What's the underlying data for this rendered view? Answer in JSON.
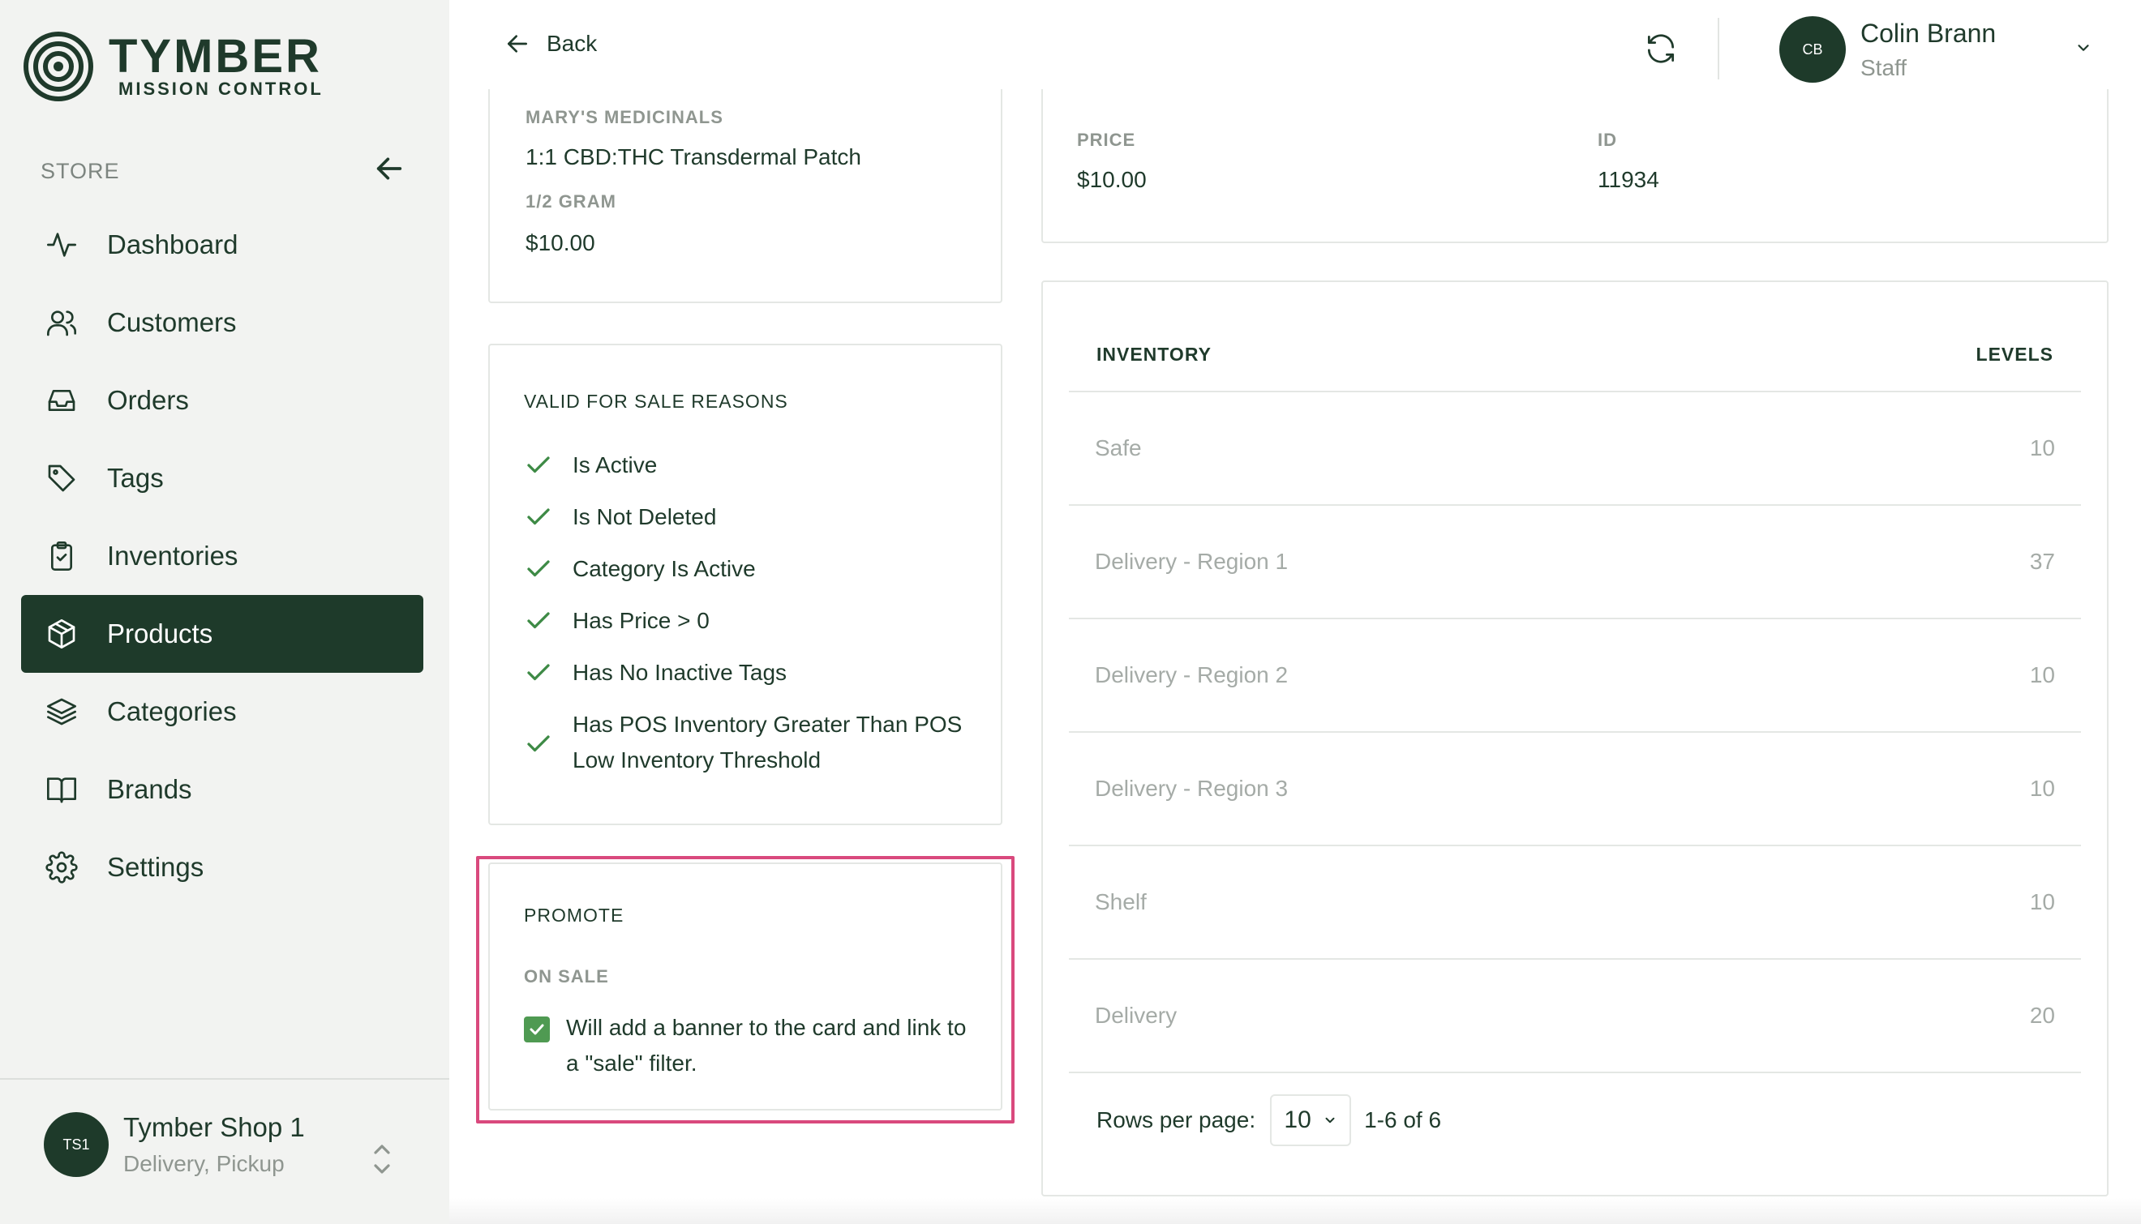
{
  "brand": {
    "title": "TYMBER",
    "subtitle": "MISSION CONTROL"
  },
  "sidebar": {
    "section_label": "STORE",
    "items": [
      {
        "label": "Dashboard",
        "icon": "activity-icon"
      },
      {
        "label": "Customers",
        "icon": "users-icon"
      },
      {
        "label": "Orders",
        "icon": "inbox-icon"
      },
      {
        "label": "Tags",
        "icon": "tag-icon"
      },
      {
        "label": "Inventories",
        "icon": "clipboard-check-icon"
      },
      {
        "label": "Products",
        "icon": "box-icon",
        "active": true
      },
      {
        "label": "Categories",
        "icon": "layers-icon"
      },
      {
        "label": "Brands",
        "icon": "book-open-icon"
      },
      {
        "label": "Settings",
        "icon": "gear-icon"
      }
    ],
    "shop": {
      "avatar": "TS1",
      "name": "Tymber Shop 1",
      "subtitle": "Delivery, Pickup"
    }
  },
  "header": {
    "back_label": "Back",
    "user": {
      "avatar": "CB",
      "name": "Colin Brann",
      "role": "Staff"
    }
  },
  "product": {
    "brand": "MARY'S MEDICINALS",
    "name": "1:1 CBD:THC Transdermal Patch",
    "size": "1/2 GRAM",
    "price": "$10.00"
  },
  "valid_for_sale": {
    "title": "VALID FOR SALE REASONS",
    "reasons": [
      "Is Active",
      "Is Not Deleted",
      "Category Is Active",
      "Has Price > 0",
      "Has No Inactive Tags",
      "Has POS Inventory Greater Than POS Low Inventory Threshold"
    ]
  },
  "promote": {
    "title": "PROMOTE",
    "on_sale_label": "ON SALE",
    "on_sale_checked": true,
    "on_sale_description": "Will add a banner to the card and link to a \"sale\" filter."
  },
  "details": {
    "price_label": "PRICE",
    "price": "$10.00",
    "id_label": "ID",
    "id": "11934"
  },
  "inventory": {
    "header_left": "INVENTORY",
    "header_right": "LEVELS",
    "rows": [
      {
        "name": "Safe",
        "level": "10"
      },
      {
        "name": "Delivery - Region 1",
        "level": "37"
      },
      {
        "name": "Delivery - Region 2",
        "level": "10"
      },
      {
        "name": "Delivery - Region 3",
        "level": "10"
      },
      {
        "name": "Shelf",
        "level": "10"
      },
      {
        "name": "Delivery",
        "level": "20"
      }
    ],
    "rows_per_page_label": "Rows per page:",
    "rows_per_page": "10",
    "range": "1-6 of 6"
  },
  "colors": {
    "brand_dark": "#1e3a2a",
    "check_green": "#3d8a45",
    "highlight": "#d9497d",
    "sidebar_bg": "#f2f3f1"
  }
}
